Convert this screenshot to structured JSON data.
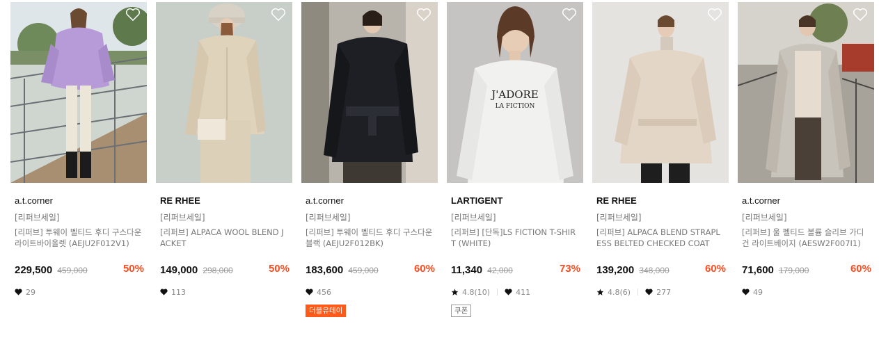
{
  "products": [
    {
      "brand": "a.t.corner",
      "tag": "[리퍼브세일]",
      "name": "[리퍼브] 투웨이 벨티드 후디 구스다운 라이트바이올렛 (AEJU2F012V1)",
      "price": "229,500",
      "original": "459,000",
      "discount": "50%",
      "likes": "29"
    },
    {
      "brand": "RE RHEE",
      "tag": "[리퍼브세일]",
      "name": "[리퍼브] ALPACA WOOL BLEND JACKET",
      "price": "149,000",
      "original": "298,000",
      "discount": "50%",
      "likes": "113"
    },
    {
      "brand": "a.t.corner",
      "tag": "[리퍼브세일]",
      "name": "[리퍼브] 투웨이 벨티드 후디 구스다운 블랙 (AEJU2F012BK)",
      "price": "183,600",
      "original": "459,000",
      "discount": "60%",
      "likes": "456",
      "badge": "더블유데이"
    },
    {
      "brand": "LARTIGENT",
      "tag": "[리퍼브세일]",
      "name": "[리퍼브] [단독]LS FICTION T-SHIRT (WHITE)",
      "price": "11,340",
      "original": "42,000",
      "discount": "73%",
      "rating": "4.8(10)",
      "likes": "411",
      "badge": "쿠폰"
    },
    {
      "brand": "RE RHEE",
      "tag": "[리퍼브세일]",
      "name": "[리퍼브] ALPACA BLEND STRAPLESS BELTED CHECKED COAT",
      "price": "139,200",
      "original": "348,000",
      "discount": "60%",
      "rating": "4.8(6)",
      "likes": "277"
    },
    {
      "brand": "a.t.corner",
      "tag": "[리퍼브세일]",
      "name": "[리퍼브] 울 펠티드 볼륨 슬리브 가디건 라이트베이지 (AESW2F007I1)",
      "price": "71,600",
      "original": "179,000",
      "discount": "60%",
      "likes": "49"
    }
  ],
  "shirt_print": {
    "line1": "J'ADORE",
    "line2": "LA FICTION"
  },
  "colors": {
    "discount": "#ff4b1f",
    "badge": "#ff5a1a"
  },
  "icons": {
    "wishlist": "heart-outline-icon",
    "likes": "heart-icon",
    "rating": "star-icon"
  }
}
